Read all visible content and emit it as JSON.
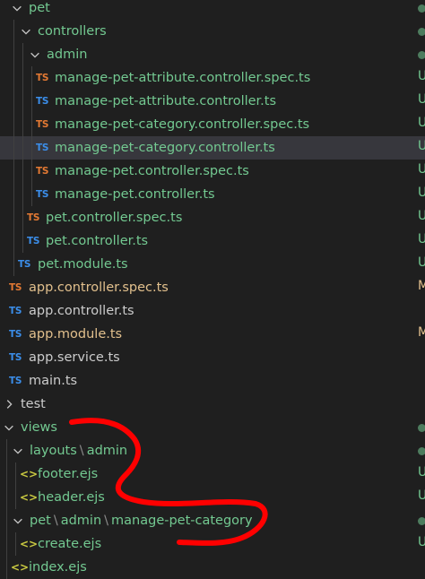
{
  "colors": {
    "background": "#1f1f1f",
    "selected_row": "#37373d",
    "untracked_green": "#73c991",
    "modified_yellow": "#e2c08d",
    "ts_blue": "#3b8eea",
    "ts_spec_orange": "#e37933",
    "ejs_yellow": "#cbcb41",
    "annotation_red": "#ff0000"
  },
  "tree": {
    "pet": {
      "label": "pet"
    },
    "controllers": {
      "label": "controllers"
    },
    "admin": {
      "label": "admin"
    },
    "f1": {
      "label": "manage-pet-attribute.controller.spec.ts",
      "icon": "TS",
      "status": "U"
    },
    "f2": {
      "label": "manage-pet-attribute.controller.ts",
      "icon": "TS",
      "status": "U"
    },
    "f3": {
      "label": "manage-pet-category.controller.spec.ts",
      "icon": "TS",
      "status": "U"
    },
    "f4": {
      "label": "manage-pet-category.controller.ts",
      "icon": "TS",
      "status": "U"
    },
    "f5": {
      "label": "manage-pet.controller.spec.ts",
      "icon": "TS",
      "status": "U"
    },
    "f6": {
      "label": "manage-pet.controller.ts",
      "icon": "TS",
      "status": "U"
    },
    "f7": {
      "label": "pet.controller.spec.ts",
      "icon": "TS",
      "status": "U"
    },
    "f8": {
      "label": "pet.controller.ts",
      "icon": "TS",
      "status": "U"
    },
    "f9": {
      "label": "pet.module.ts",
      "icon": "TS",
      "status": "U"
    },
    "f10": {
      "label": "app.controller.spec.ts",
      "icon": "TS",
      "status": "M"
    },
    "f11": {
      "label": "app.controller.ts",
      "icon": "TS"
    },
    "f12": {
      "label": "app.module.ts",
      "icon": "TS",
      "status": "M"
    },
    "f13": {
      "label": "app.service.ts",
      "icon": "TS"
    },
    "f14": {
      "label": "main.ts",
      "icon": "TS"
    },
    "test": {
      "label": "test"
    },
    "views": {
      "label": "views"
    },
    "layouts": {
      "part1": "layouts",
      "sep": "\\",
      "part2": "admin"
    },
    "footer": {
      "label": "footer.ejs",
      "icon": "<>",
      "status": "U"
    },
    "header": {
      "label": "header.ejs",
      "icon": "<>",
      "status": "U"
    },
    "petpath": {
      "part1": "pet",
      "sep1": "\\",
      "part2": "admin",
      "sep2": "\\",
      "part3": "manage-pet-category"
    },
    "create": {
      "label": "create.ejs",
      "icon": "<>",
      "status": "U"
    },
    "partial_last": {
      "label": "index.ejs"
    }
  }
}
